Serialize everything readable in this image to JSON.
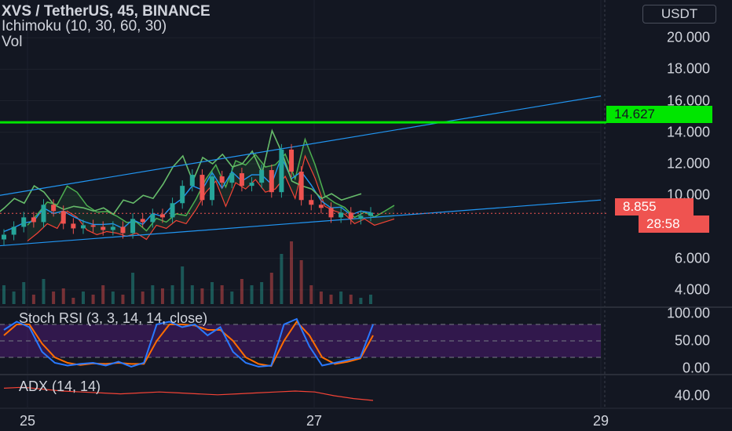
{
  "header": {
    "title": "XVS / TetherUS, 45, BINANCE",
    "indicator": "Ichimoku (10, 30, 60, 30)",
    "volume": "Vol"
  },
  "currency": "USDT",
  "panes": {
    "stoch": "Stoch RSI (3, 3, 14, 14, close)",
    "adx": "ADX (14, 14)"
  },
  "colors": {
    "bg": "#131722",
    "up": "#26a69a",
    "down": "#ef5350",
    "channel": "#2196f3",
    "resistance": "#00e600",
    "stoch_k": "#2979ff",
    "stoch_d": "#ff6d00",
    "stoch_band": "#6a1b9a",
    "ichimoku_span_a": "#4caf50",
    "ichimoku_span_b": "#f44336",
    "adx": "#f44336"
  },
  "chart_data": {
    "type": "candlestick",
    "symbol": "XVS / TetherUS",
    "interval": "45",
    "exchange": "BINANCE",
    "price_axis": {
      "ticks": [
        "20.000",
        "18.000",
        "16.000",
        "14.000",
        "12.000",
        "10.000",
        "6.000",
        "4.000"
      ],
      "range": [
        3.0,
        21.0
      ]
    },
    "x_axis": {
      "labels": [
        "25",
        "27",
        "29"
      ]
    },
    "horizontal_line": {
      "value": 14.627,
      "label": "14.627"
    },
    "last_price": {
      "value": 8.855,
      "label": "8.855",
      "countdown": "28:58"
    },
    "channel": {
      "upper": [
        [
          0,
          10.0
        ],
        [
          100,
          16.3
        ]
      ],
      "lower": [
        [
          0,
          6.8
        ],
        [
          100,
          9.7
        ]
      ]
    },
    "ohlc_close_approx": [
      7.5,
      8.0,
      8.6,
      8.3,
      9.4,
      9.0,
      8.2,
      7.9,
      8.1,
      8.0,
      7.8,
      8.0,
      7.6,
      8.5,
      8.3,
      8.8,
      8.6,
      9.5,
      10.6,
      11.3,
      9.7,
      11.2,
      10.8,
      11.4,
      10.6,
      10.8,
      11.6,
      10.2,
      12.9,
      11.5,
      9.7,
      9.4,
      9.2,
      8.6,
      8.9,
      8.5,
      8.7,
      8.9
    ],
    "volume_relative": [
      0.3,
      0.2,
      0.35,
      0.15,
      0.4,
      0.2,
      0.25,
      0.1,
      0.2,
      0.15,
      0.3,
      0.2,
      0.15,
      0.5,
      0.2,
      0.3,
      0.25,
      0.3,
      0.6,
      0.3,
      0.25,
      0.35,
      0.3,
      0.2,
      0.4,
      0.3,
      0.35,
      0.5,
      0.8,
      1.0,
      0.7,
      0.3,
      0.2,
      0.15,
      0.2,
      0.15,
      0.1,
      0.15
    ],
    "stoch_rsi": {
      "ticks": [
        "100.00",
        "50.00",
        "0.00"
      ],
      "range": [
        0,
        100
      ],
      "band": [
        20,
        80
      ],
      "k": [
        70,
        85,
        75,
        30,
        10,
        5,
        8,
        10,
        5,
        12,
        3,
        10,
        80,
        85,
        75,
        80,
        60,
        75,
        30,
        10,
        3,
        5,
        80,
        90,
        40,
        5,
        10,
        15,
        20,
        80
      ],
      "d": [
        60,
        80,
        80,
        45,
        20,
        10,
        6,
        9,
        8,
        10,
        8,
        8,
        50,
        80,
        80,
        78,
        70,
        70,
        50,
        20,
        8,
        4,
        50,
        85,
        60,
        20,
        8,
        12,
        18,
        60
      ]
    },
    "adx": {
      "ticks": [
        "40.00"
      ],
      "values": [
        48,
        49,
        47,
        45,
        44,
        43,
        42,
        43,
        44,
        43,
        42,
        41,
        42,
        43,
        44,
        45,
        44,
        40,
        37,
        35
      ]
    }
  }
}
